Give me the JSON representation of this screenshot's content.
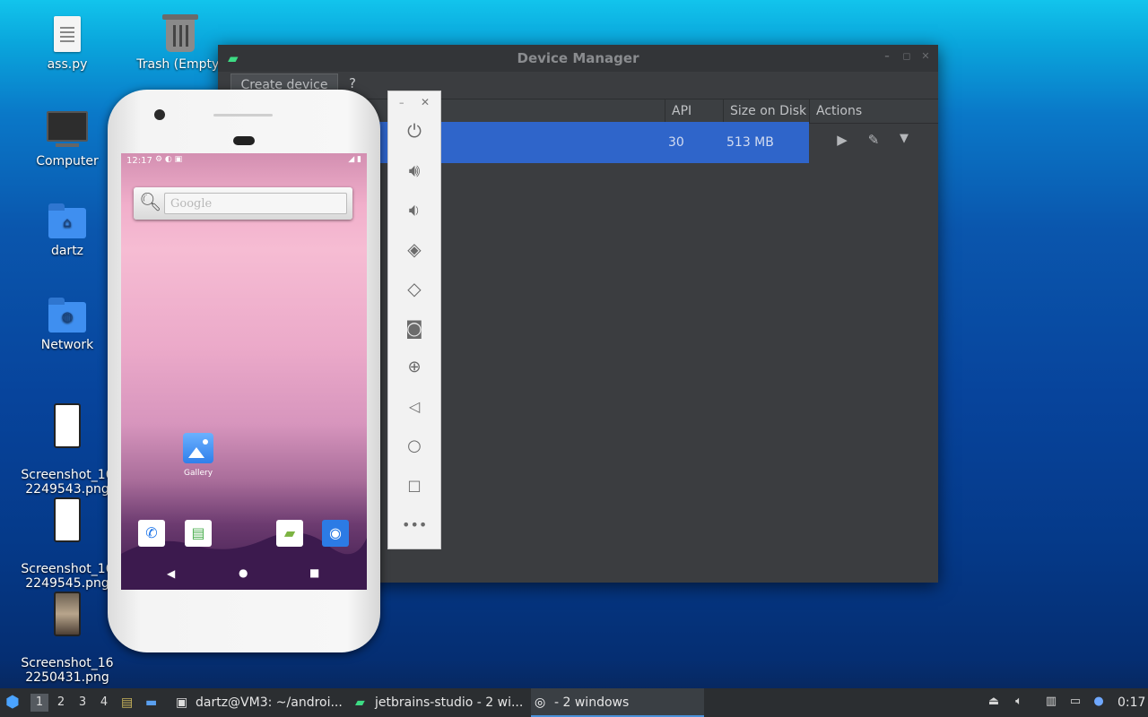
{
  "desktop": {
    "icons": [
      {
        "label": "ass.py",
        "icon": "python-file-icon"
      },
      {
        "label": "Trash (Empty)",
        "icon": "trash-icon"
      },
      {
        "label": "Computer",
        "icon": "computer-icon"
      },
      {
        "label": "dartz",
        "icon": "home-folder-icon"
      },
      {
        "label": "Network",
        "icon": "network-folder-icon"
      },
      {
        "label": "Screenshot_16\n2249543.png",
        "icon": "image-file-icon"
      },
      {
        "label": "Screenshot_16\n2249545.png",
        "icon": "image-file-icon"
      },
      {
        "label": "Screenshot_16\n2250431.png",
        "icon": "image-file-icon"
      }
    ]
  },
  "device_manager": {
    "title": "Device Manager",
    "create_button": "Create device",
    "help": "?",
    "columns": [
      "API",
      "Size on Disk",
      "Actions"
    ],
    "rows": [
      {
        "api": "30",
        "size": "513 MB"
      }
    ],
    "actions": [
      "play-icon",
      "edit-icon",
      "dropdown-icon"
    ]
  },
  "emulator": {
    "status_time": "12:17",
    "search_placeholder": "Google",
    "gallery_label": "Gallery",
    "dock_apps": [
      "phone-icon",
      "store-icon",
      "android-icon",
      "camera-icon"
    ],
    "toolbar": [
      "power-icon",
      "volume-up-icon",
      "volume-down-icon",
      "rotate-left-icon",
      "rotate-right-icon",
      "camera-icon",
      "zoom-icon",
      "back-icon",
      "home-icon",
      "overview-icon",
      "more-icon"
    ]
  },
  "taskbar": {
    "workspaces": [
      "1",
      "2",
      "3",
      "4"
    ],
    "tasks": [
      {
        "label": "dartz@VM3: ~/androi...",
        "icon": "terminal-icon"
      },
      {
        "label": "jetbrains-studio - 2 wi...",
        "icon": "android-icon"
      },
      {
        "label": "- 2 windows",
        "icon": "emulator-icon"
      }
    ],
    "clock": "0:17"
  }
}
